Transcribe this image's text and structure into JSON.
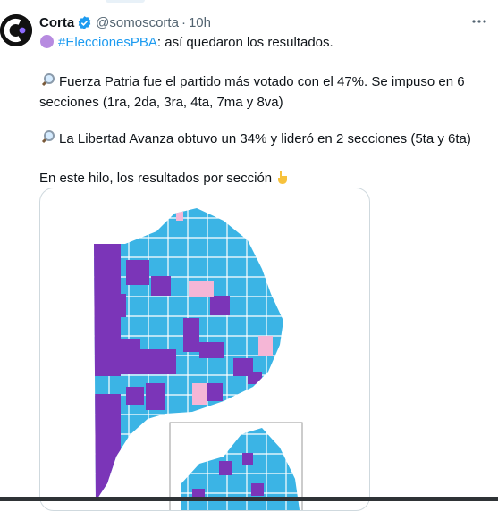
{
  "tweet": {
    "author_name": "Corta",
    "handle": "@somoscorta",
    "separator": "·",
    "time": "10h",
    "line1_hashtag": "#EleccionesPBA",
    "line1_rest": ": así quedaron los resultados.",
    "para2": "Fuerza Patria fue el partido más votado con el 47%. Se impuso en 6 secciones (1ra, 2da, 3ra, 4ta, 7ma y 8va)",
    "para3": "La Libertad Avanza obtuvo un 34% y lideró en 2 secciones (5ta y 6ta)",
    "para4": "En este hilo, los resultados por sección"
  },
  "icons": {
    "avatar": "corta-logo",
    "verified": "verified-badge-icon",
    "purple_circle": "purple-circle-emoji",
    "magnifier": "magnifying-glass-emoji",
    "pointing": "pointing-down-emoji",
    "more": "more-icon"
  },
  "colors": {
    "link": "#1d9bf0",
    "map_blue": "#3bb4e5",
    "map_purple": "#7b35b8",
    "map_pink": "#f5b6d6"
  }
}
